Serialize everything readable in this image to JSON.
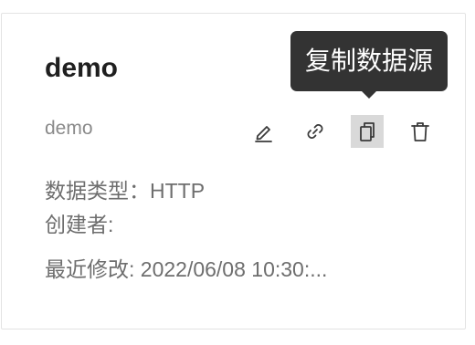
{
  "card": {
    "title": "demo",
    "subtitle": "demo",
    "type_line": "数据类型：HTTP",
    "creator_line": "创建者:",
    "modified_line": "最近修改: 2022/06/08 10:30:..."
  },
  "actions": {
    "edit_icon": "pencil-icon",
    "link_icon": "link-icon",
    "copy_icon": "copy-icon",
    "delete_icon": "trash-icon"
  },
  "tooltip": {
    "text": "复制数据源"
  },
  "colors": {
    "tooltip_bg": "#333333",
    "hover_bg": "#d9d9d9",
    "title": "#1f1f1f",
    "muted": "#8a8a8a"
  }
}
